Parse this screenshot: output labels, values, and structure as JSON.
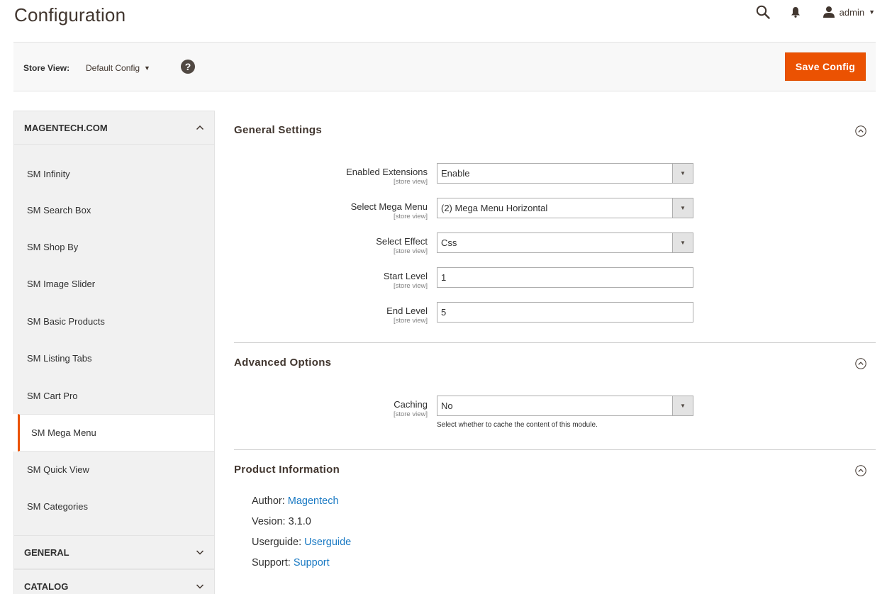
{
  "page": {
    "title": "Configuration"
  },
  "header": {
    "user_name": "admin"
  },
  "toolbar": {
    "scope_label": "Store View:",
    "scope_value": "Default Config",
    "help_symbol": "?",
    "save_label": "Save Config"
  },
  "sidebar": {
    "group_main": "MAGENTECH.COM",
    "items": [
      {
        "label": "SM Infinity"
      },
      {
        "label": "SM Search Box"
      },
      {
        "label": "SM Shop By"
      },
      {
        "label": "SM Image Slider"
      },
      {
        "label": "SM Basic Products"
      },
      {
        "label": "SM Listing Tabs"
      },
      {
        "label": "SM Cart Pro"
      },
      {
        "label": "SM Mega Menu"
      },
      {
        "label": "SM Quick View"
      },
      {
        "label": "SM Categories"
      }
    ],
    "group_general": "GENERAL",
    "group_catalog": "CATALOG"
  },
  "sections": {
    "general": {
      "title": "General Settings",
      "enabled": {
        "label": "Enabled Extensions",
        "scope": "[store view]",
        "value": "Enable"
      },
      "mega_menu": {
        "label": "Select Mega Menu",
        "scope": "[store view]",
        "value": "(2) Mega Menu Horizontal"
      },
      "effect": {
        "label": "Select Effect",
        "scope": "[store view]",
        "value": "Css"
      },
      "start_level": {
        "label": "Start Level",
        "scope": "[store view]",
        "value": "1"
      },
      "end_level": {
        "label": "End Level",
        "scope": "[store view]",
        "value": "5"
      }
    },
    "advanced": {
      "title": "Advanced Options",
      "caching": {
        "label": "Caching",
        "scope": "[store view]",
        "value": "No",
        "hint": "Select whether to cache the content of this module."
      }
    },
    "product": {
      "title": "Product Information",
      "author_label": "Author:",
      "author_link": "Magentech",
      "version_text": "Vesion: 3.1.0",
      "guide_label": "Userguide:",
      "guide_link": "Userguide",
      "support_label": "Support:",
      "support_link": "Support"
    }
  },
  "colors": {
    "accent": "#eb5202",
    "link": "#1979c3"
  }
}
